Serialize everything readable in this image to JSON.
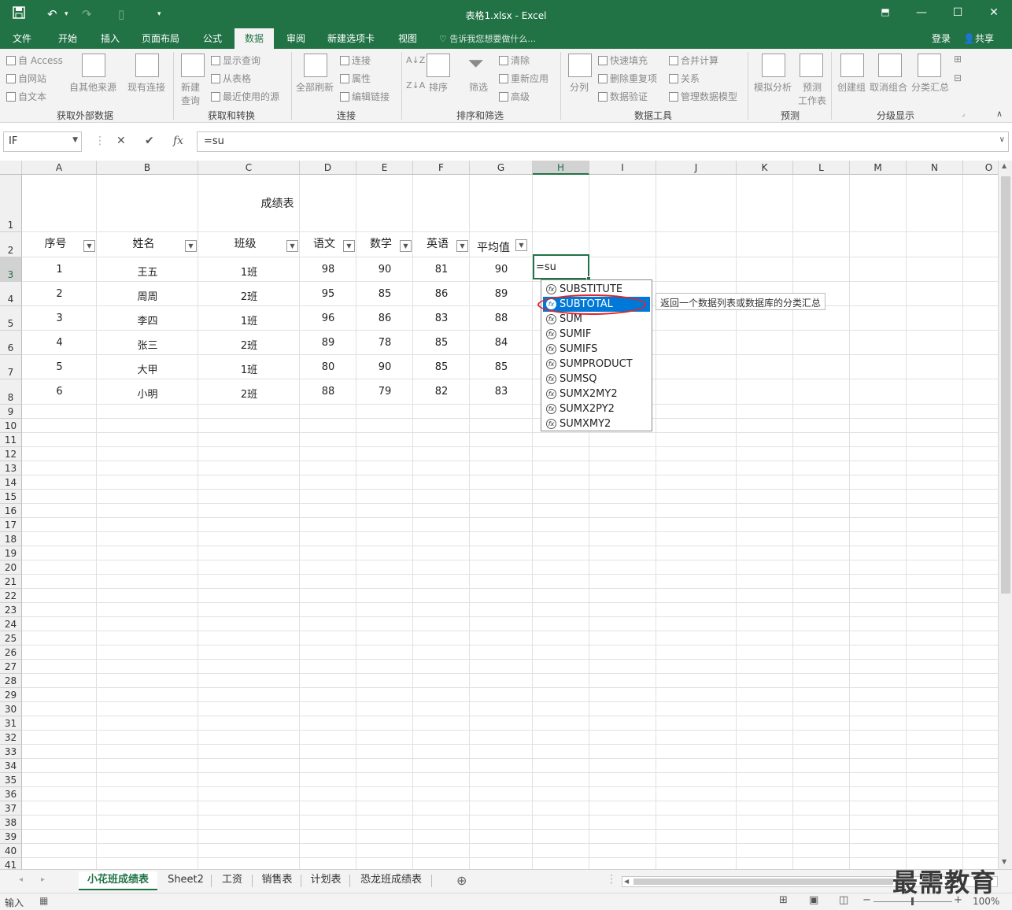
{
  "window": {
    "title": "表格1.xlsx - Excel",
    "qat": {
      "save": "save-icon",
      "undo": "undo-icon",
      "redo": "redo-icon",
      "new": "new-doc-icon",
      "customize": "dropdown-icon"
    },
    "controls": {
      "restore_ribbon": "ribbon-display-icon",
      "minimize": "—",
      "maximize": "☐",
      "close": "✕"
    }
  },
  "tabs": [
    "文件",
    "开始",
    "插入",
    "页面布局",
    "公式",
    "数据",
    "审阅",
    "新建选项卡",
    "视图"
  ],
  "active_tab": "数据",
  "tell_me": "告诉我您想要做什么...",
  "account": {
    "login": "登录",
    "share": "共享"
  },
  "ribbon": {
    "get_external": {
      "label": "获取外部数据",
      "access": "自 Access",
      "web": "自网站",
      "text": "自文本",
      "other": "自其他来源",
      "existing": "现有连接"
    },
    "get_transform": {
      "label": "获取和转换",
      "new_query_line1": "新建",
      "new_query_line2": "查询",
      "show_queries": "显示查询",
      "from_table": "从表格",
      "recent_sources": "最近使用的源"
    },
    "connections": {
      "label": "连接",
      "refresh_all": "全部刷新",
      "connections": "连接",
      "properties": "属性",
      "edit_links": "编辑链接"
    },
    "sort_filter": {
      "label": "排序和筛选",
      "sort": "排序",
      "filter": "筛选",
      "clear": "清除",
      "reapply": "重新应用",
      "advanced": "高级"
    },
    "data_tools": {
      "label": "数据工具",
      "split": "分列",
      "flash_fill": "快速填充",
      "remove_dup": "删除重复项",
      "validation": "数据验证",
      "consolidate": "合并计算",
      "relations": "关系",
      "manage_model": "管理数据模型"
    },
    "forecast": {
      "label": "预测",
      "whatif": "模拟分析",
      "sheet_line1": "预测",
      "sheet_line2": "工作表"
    },
    "outline": {
      "label": "分级显示",
      "group": "创建组",
      "ungroup": "取消组合",
      "subtotal": "分类汇总"
    }
  },
  "formula_bar": {
    "name_box": "IF",
    "cancel": "✕",
    "enter": "✔",
    "fx": "fx",
    "value": "=su"
  },
  "columns": [
    "A",
    "B",
    "C",
    "D",
    "E",
    "F",
    "G",
    "H",
    "I",
    "J",
    "K",
    "L",
    "M",
    "N",
    "O"
  ],
  "selected_column": "H",
  "rows": [
    "1",
    "2",
    "3",
    "4",
    "5",
    "6",
    "7",
    "8",
    "9",
    "10",
    "11",
    "12",
    "13",
    "14",
    "15",
    "16",
    "17",
    "18",
    "19",
    "20",
    "21",
    "22",
    "23",
    "24",
    "25",
    "26",
    "27",
    "28",
    "29",
    "30",
    "31",
    "32",
    "33",
    "34",
    "35",
    "36",
    "37",
    "38",
    "39",
    "40",
    "41"
  ],
  "selected_row": "3",
  "sheet": {
    "title": "成绩表",
    "headers": [
      "序号",
      "姓名",
      "班级",
      "语文",
      "数学",
      "英语",
      "平均值"
    ],
    "data": [
      [
        "1",
        "王五",
        "1班",
        "98",
        "90",
        "81",
        "90"
      ],
      [
        "2",
        "周周",
        "2班",
        "95",
        "85",
        "86",
        "89"
      ],
      [
        "3",
        "李四",
        "1班",
        "96",
        "86",
        "83",
        "88"
      ],
      [
        "4",
        "张三",
        "2班",
        "89",
        "78",
        "85",
        "84"
      ],
      [
        "5",
        "大甲",
        "1班",
        "80",
        "90",
        "85",
        "85"
      ],
      [
        "6",
        "小明",
        "2班",
        "88",
        "79",
        "82",
        "83"
      ]
    ],
    "active_cell_text": "=su"
  },
  "autocomplete": {
    "items": [
      "SUBSTITUTE",
      "SUBTOTAL",
      "SUM",
      "SUMIF",
      "SUMIFS",
      "SUMPRODUCT",
      "SUMSQ",
      "SUMX2MY2",
      "SUMX2PY2",
      "SUMXMY2"
    ],
    "highlighted": "SUBTOTAL",
    "tooltip": "返回一个数据列表或数据库的分类汇总"
  },
  "sheet_tabs": [
    "小花班成绩表",
    "Sheet2",
    "工资",
    "销售表",
    "计划表",
    "恐龙班成绩表"
  ],
  "active_sheet": "小花班成绩表",
  "status": {
    "mode": "输入",
    "zoom": "100%"
  },
  "watermark": "最需教育"
}
